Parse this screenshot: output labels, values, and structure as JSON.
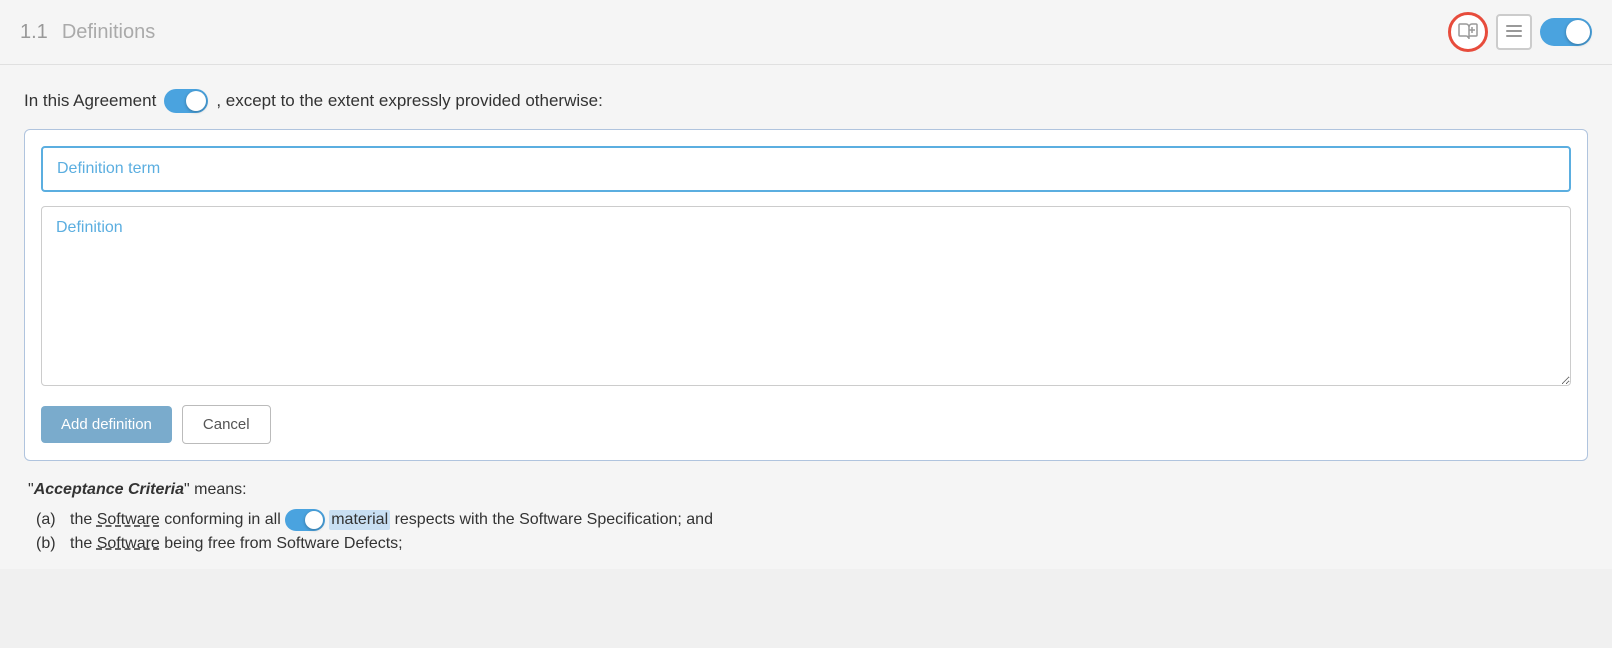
{
  "header": {
    "section_number": "1.1",
    "section_title": "Definitions",
    "icons": {
      "book_icon_label": "📖+",
      "list_icon_label": "≡",
      "toggle_on": true
    }
  },
  "intro": {
    "text_before": "In this Agreement",
    "toggle_on": true,
    "text_after": ", except to the extent expressly provided otherwise:"
  },
  "form": {
    "term_placeholder": "Definition term",
    "definition_placeholder": "Definition",
    "add_button_label": "Add definition",
    "cancel_button_label": "Cancel"
  },
  "definitions": [
    {
      "term": "Acceptance Criteria",
      "means_text": "\" means:",
      "sub_items": [
        {
          "label": "(a)",
          "text_before": "the",
          "dashed_word": "Software",
          "text_middle": "conforming in all",
          "toggle_word": "material",
          "text_after": "respects with the Software Specification; and"
        },
        {
          "label": "(b)",
          "text": "the Software being free from Software Defects;"
        }
      ]
    }
  ]
}
